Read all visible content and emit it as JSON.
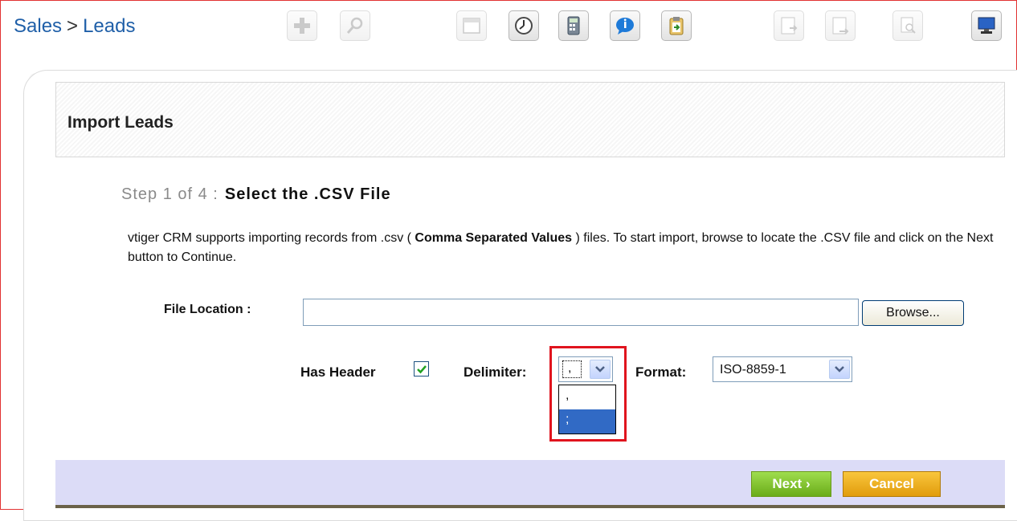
{
  "breadcrumb": {
    "module": "Sales",
    "separator": ">",
    "page": "Leads"
  },
  "toolbar": {
    "buttons": [
      {
        "icon": "add-icon",
        "state": "disabled"
      },
      {
        "icon": "search-icon",
        "state": "disabled"
      },
      {
        "icon": "calendar-icon",
        "state": "disabled"
      },
      {
        "icon": "clock-icon",
        "state": "enabled"
      },
      {
        "icon": "calculator-icon",
        "state": "enabled"
      },
      {
        "icon": "chat-icon",
        "state": "enabled"
      },
      {
        "icon": "clipboard-import-icon",
        "state": "enabled"
      },
      {
        "icon": "import-icon",
        "state": "disabled"
      },
      {
        "icon": "export-icon",
        "state": "disabled"
      },
      {
        "icon": "find-duplicates-icon",
        "state": "disabled"
      },
      {
        "icon": "monitor-icon",
        "state": "enabled"
      }
    ]
  },
  "import": {
    "title": "Import Leads",
    "step_prefix": "Step 1 of 4 :",
    "step_title": "Select the .CSV File",
    "description_part1": "vtiger CRM supports importing records from .csv ( ",
    "description_bold": "Comma Separated Values",
    "description_part2": " ) files. To start import, browse to locate the .CSV file and click on the Next button to Continue.",
    "file_location_label": "File Location :",
    "file_location_value": "",
    "browse_label": "Browse...",
    "has_header_label": "Has Header",
    "has_header_checked": true,
    "delimiter_label": "Delimiter:",
    "delimiter_value": ",",
    "delimiter_options": [
      ",",
      ";"
    ],
    "delimiter_highlighted_option": ";",
    "format_label": "Format:",
    "format_value": "ISO-8859-1"
  },
  "footer": {
    "next_label": "Next ›",
    "cancel_label": "Cancel"
  },
  "colors": {
    "breadcrumb_link": "#1f5fa8",
    "footer_bg": "#dcdcf7",
    "next_button": "#6aac19",
    "cancel_button": "#e19c0c",
    "highlight": "#e0141e",
    "selected_option": "#316ac5"
  }
}
